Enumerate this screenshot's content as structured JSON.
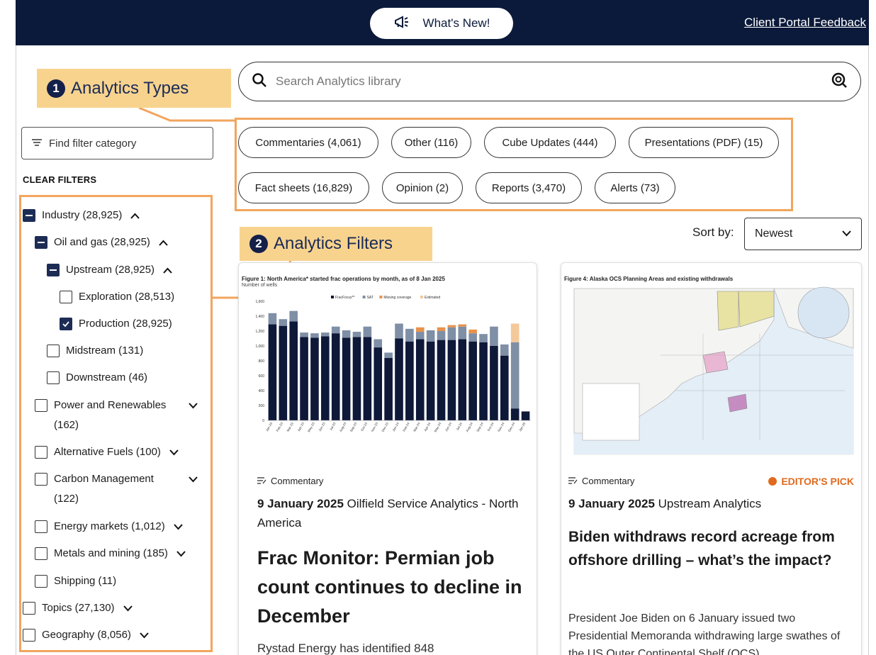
{
  "header": {
    "whats_new": "What's New!",
    "feedback": "Client Portal Feedback"
  },
  "search": {
    "placeholder": "Search Analytics library"
  },
  "callouts": [
    {
      "num": "1",
      "label": "Analytics Types"
    },
    {
      "num": "2",
      "label": "Analytics Filters"
    }
  ],
  "chips": [
    "Commentaries (4,061)",
    "Other (116)",
    "Cube Updates (444)",
    "Presentations (PDF) (15)",
    "Fact sheets (16,829)",
    "Opinion (2)",
    "Reports (3,470)",
    "Alerts (73)"
  ],
  "filters": {
    "find_placeholder": "Find filter category",
    "clear": "CLEAR FILTERS",
    "items": [
      {
        "label": "Industry (28,925)",
        "state": "minus",
        "chevron": "up"
      },
      {
        "label": "Oil and gas (28,925)",
        "state": "minus",
        "chevron": "up"
      },
      {
        "label": "Upstream (28,925)",
        "state": "minus",
        "chevron": "up"
      },
      {
        "label": "Exploration (28,513)",
        "state": "unchecked",
        "chevron": ""
      },
      {
        "label": "Production (28,925)",
        "state": "checked",
        "chevron": ""
      },
      {
        "label": "Midstream (131)",
        "state": "unchecked",
        "chevron": ""
      },
      {
        "label": "Downstream (46)",
        "state": "unchecked",
        "chevron": ""
      },
      {
        "label": "Power and Renewables (162)",
        "state": "unchecked",
        "chevron": "down"
      },
      {
        "label": "Alternative Fuels (100)",
        "state": "unchecked",
        "chevron": "down"
      },
      {
        "label": "Carbon Management (122)",
        "state": "unchecked",
        "chevron": "down"
      },
      {
        "label": "Energy markets (1,012)",
        "state": "unchecked",
        "chevron": "down"
      },
      {
        "label": "Metals and mining (185)",
        "state": "unchecked",
        "chevron": "down"
      },
      {
        "label": "Shipping (11)",
        "state": "unchecked",
        "chevron": ""
      },
      {
        "label": "Topics (27,130)",
        "state": "unchecked",
        "chevron": "down"
      },
      {
        "label": "Geography (8,056)",
        "state": "unchecked",
        "chevron": "down"
      }
    ]
  },
  "sort": {
    "label": "Sort by:",
    "value": "Newest"
  },
  "cards": [
    {
      "figure_title": "Figure 1: North America* started frac operations by month, as of 8 Jan 2025",
      "figure_sub": "Number of wells",
      "type": "Commentary",
      "date": "9 January 2025",
      "source": "Oilfield Service Analytics - North America",
      "title": "Frac Monitor: Permian job count continues to decline in December",
      "body": "Rystad Energy has identified 848"
    },
    {
      "figure_title": "Figure 4: Alaska OCS Planning Areas and existing withdrawals",
      "type": "Commentary",
      "editor_pick": "EDITOR'S PICK",
      "date": "9 January 2025",
      "source": "Upstream Analytics",
      "title": "Biden withdraws record acreage from offshore drilling – what’s the impact?",
      "body": "President Joe Biden on 6 January issued two Presidential Memoranda withdrawing large swathes of the US Outer Continental Shelf (OCS)"
    }
  ],
  "chart_data": {
    "type": "bar",
    "title": "Figure 1: North America* started frac operations by month, as of 8 Jan 2025",
    "ylabel": "Number of wells",
    "ylim": [
      0,
      1600
    ],
    "legend": [
      "FracFocus**",
      "SAT",
      "Missing coverage",
      "Estimated"
    ],
    "categories": [
      "Jan-23",
      "Feb-23",
      "Mar-23",
      "Apr-23",
      "May-23",
      "Jun-23",
      "Jul-23",
      "Aug-23",
      "Sep-23",
      "Oct-23",
      "Nov-23",
      "Dec-23",
      "Jan-24",
      "Feb-24",
      "Mar-24",
      "Apr-24",
      "May-24",
      "Jun-24",
      "Jul-24",
      "Aug-24",
      "Sep-24",
      "Oct-24",
      "Nov-24",
      "Dec-24",
      "Jan-25"
    ],
    "series": [
      {
        "name": "FracFocus**",
        "values": [
          1290,
          1270,
          1330,
          1120,
          1110,
          1130,
          1170,
          1110,
          1120,
          1120,
          980,
          840,
          1100,
          1060,
          1090,
          1060,
          1080,
          1080,
          1090,
          1060,
          1050,
          1000,
          870,
          160,
          120
        ]
      },
      {
        "name": "SAT",
        "values": [
          150,
          90,
          140,
          60,
          60,
          50,
          90,
          100,
          70,
          140,
          110,
          70,
          200,
          170,
          100,
          150,
          120,
          170,
          170,
          110,
          110,
          260,
          150,
          890,
          0
        ]
      },
      {
        "name": "Missing coverage",
        "values": [
          0,
          0,
          0,
          0,
          0,
          0,
          0,
          0,
          0,
          0,
          0,
          0,
          0,
          0,
          60,
          0,
          50,
          30,
          30,
          50,
          0,
          0,
          0,
          0,
          0
        ]
      },
      {
        "name": "Estimated",
        "values": [
          0,
          0,
          0,
          0,
          0,
          0,
          0,
          0,
          0,
          0,
          0,
          0,
          0,
          0,
          0,
          0,
          0,
          0,
          0,
          0,
          0,
          0,
          0,
          250,
          0
        ]
      }
    ]
  }
}
